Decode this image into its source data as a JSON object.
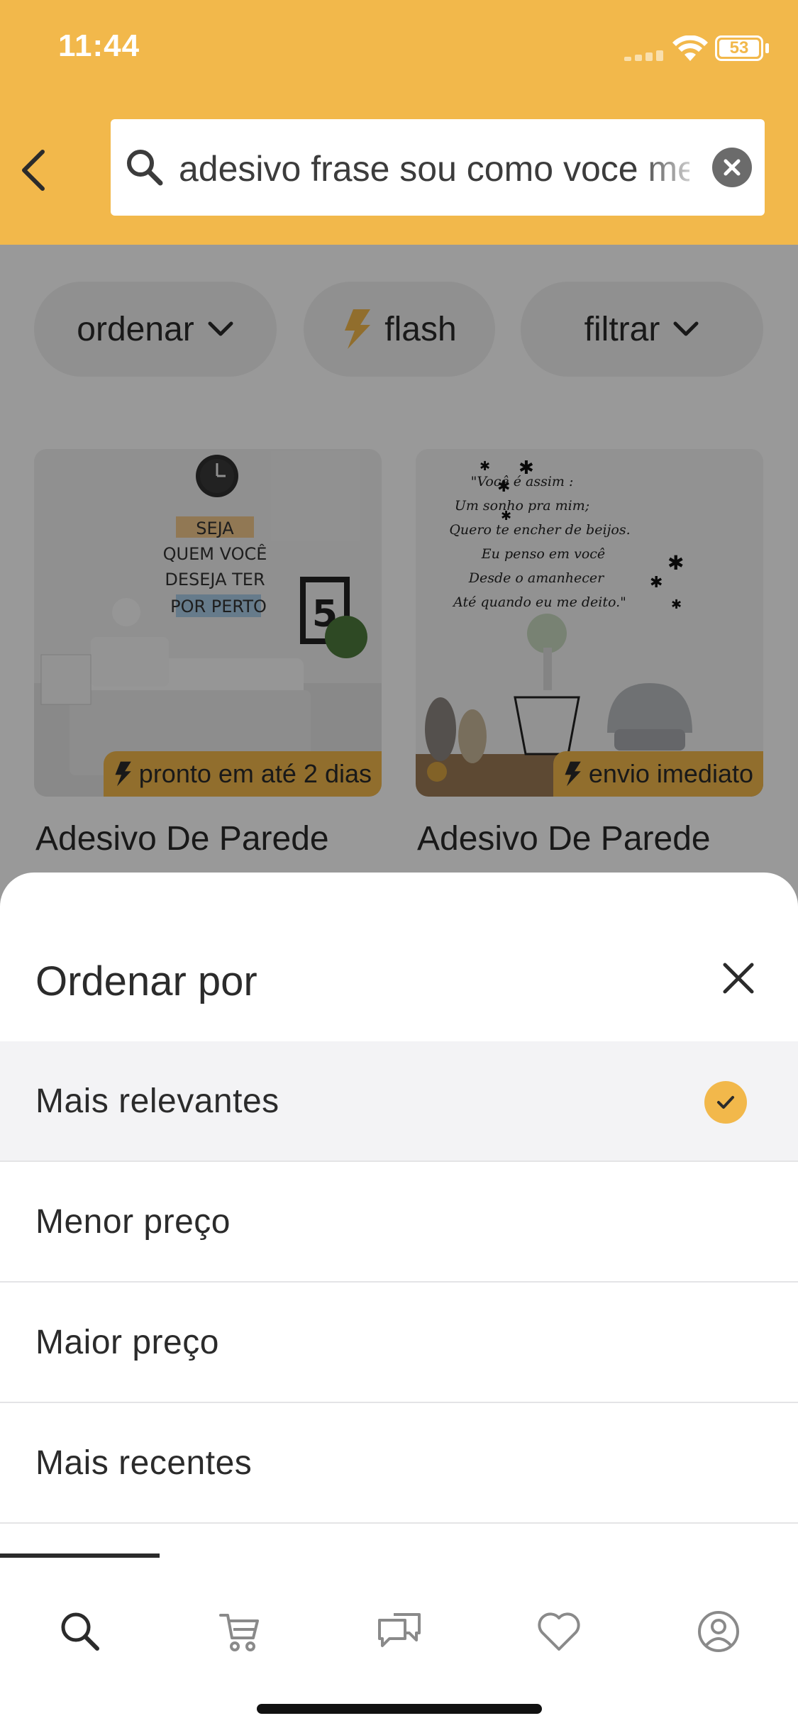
{
  "status_bar": {
    "time": "11:44",
    "battery": "53"
  },
  "search": {
    "query": "adesivo frase sou como voce me"
  },
  "filters": {
    "ordenar": "ordenar",
    "flash": "flash",
    "filtrar": "filtrar"
  },
  "products": [
    {
      "title": "Adesivo De Parede",
      "badge": "pronto em até 2 dias",
      "image_text": [
        "SEJA",
        "QUEM VOCÊ",
        "DESEJA TER",
        "POR PERTO"
      ]
    },
    {
      "title": "Adesivo De Parede",
      "badge": "envio imediato",
      "image_text": [
        "\"Você é assim :",
        "Um sonho pra mim;",
        "Quero te encher de beijos.",
        "Eu penso em você",
        "Desde o amanhecer",
        "Até quando eu me deito.\""
      ]
    }
  ],
  "sort_sheet": {
    "title": "Ordenar por",
    "options": [
      {
        "label": "Mais relevantes",
        "selected": true
      },
      {
        "label": "Menor preço",
        "selected": false
      },
      {
        "label": "Maior preço",
        "selected": false
      },
      {
        "label": "Mais recentes",
        "selected": false
      }
    ]
  },
  "tabbar": {
    "items": [
      "search-icon",
      "cart-icon",
      "chat-icon",
      "heart-icon",
      "profile-icon"
    ],
    "active": "search-icon"
  },
  "colors": {
    "brand": "#f2b84b",
    "text": "#2b2b2b",
    "selected_row": "#f3f3f5"
  }
}
